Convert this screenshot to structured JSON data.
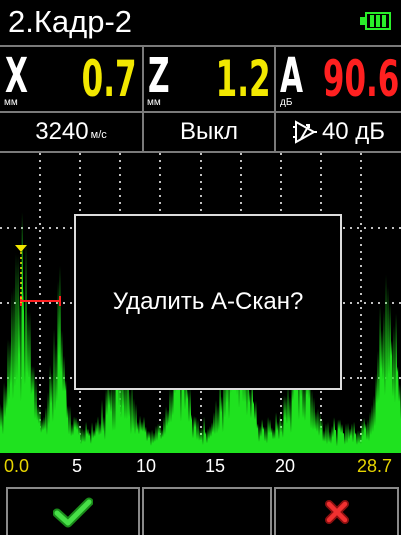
{
  "header": {
    "title": "2.Кадр-2",
    "battery_icon": "battery-full-icon",
    "battery_color": "#2aef2a"
  },
  "readings": {
    "x": {
      "letter": "X",
      "unit": "мм",
      "value": "0.7",
      "color": "#f2e800"
    },
    "z": {
      "letter": "Z",
      "unit": "мм",
      "value": "1.2",
      "color": "#f2e800"
    },
    "a": {
      "letter": "A",
      "unit": "дБ",
      "value": "90.6",
      "color": "#ff2020"
    }
  },
  "settings": {
    "velocity": "3240",
    "velocity_unit": "м/с",
    "mode": "Выкл",
    "gain_icon": "amplifier-icon",
    "gain": "40 дБ"
  },
  "scan": {
    "signal_color": "#1fe21f",
    "grid_color": "#ffffff",
    "gate_color": "#ff2020",
    "marker_color": "#f2e800"
  },
  "x_axis": {
    "ticks": [
      "0.0",
      "5",
      "10",
      "15",
      "20",
      "28.7"
    ]
  },
  "dialog": {
    "message": "Удалить А-Скан?"
  },
  "softkeys": {
    "confirm_icon": "checkmark-icon",
    "confirm_color": "#2fd02f",
    "cancel_icon": "close-icon",
    "cancel_color": "#e02020"
  }
}
